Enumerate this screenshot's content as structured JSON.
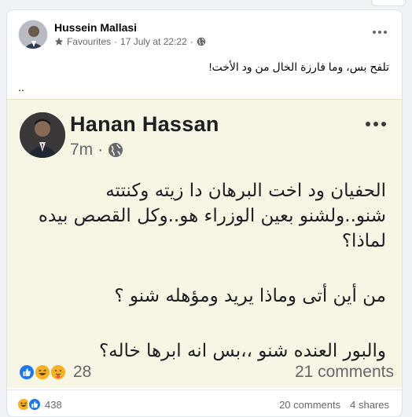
{
  "post": {
    "author": "Hussein Mallasi",
    "audience": "Favourites",
    "separator": "·",
    "date": "17 July at 22:22",
    "caption": "تلفح بس، وما فارزة الخال من ود الأخت!",
    "ellipsis": ".."
  },
  "shared": {
    "author": "Hanan Hassan",
    "time": "7m",
    "separator": "·",
    "lines": [
      "الحفيان ود اخت البرهان دا زيته وكنتته",
      "شنو..ولشنو بعين الوزراء هو..وكل القصص بيده",
      "لماذا؟",
      "من أين أتى وماذا يريد ومؤهله شنو ؟",
      "والبور العنده شنو ،،بس انه ابرها خاله؟"
    ],
    "reaction_count": "28",
    "comments": "21 comments"
  },
  "footer": {
    "reaction_count": "438",
    "comments": "20 comments",
    "shares": "4 shares"
  },
  "colors": {
    "like": "#1877f2",
    "haha": "#f7b125",
    "card_bg": "#f7f5e4",
    "muted": "#65676b"
  },
  "icons": [
    "star-icon",
    "globe-icon",
    "more-icon",
    "like-icon",
    "haha-icon",
    "care-icon"
  ]
}
